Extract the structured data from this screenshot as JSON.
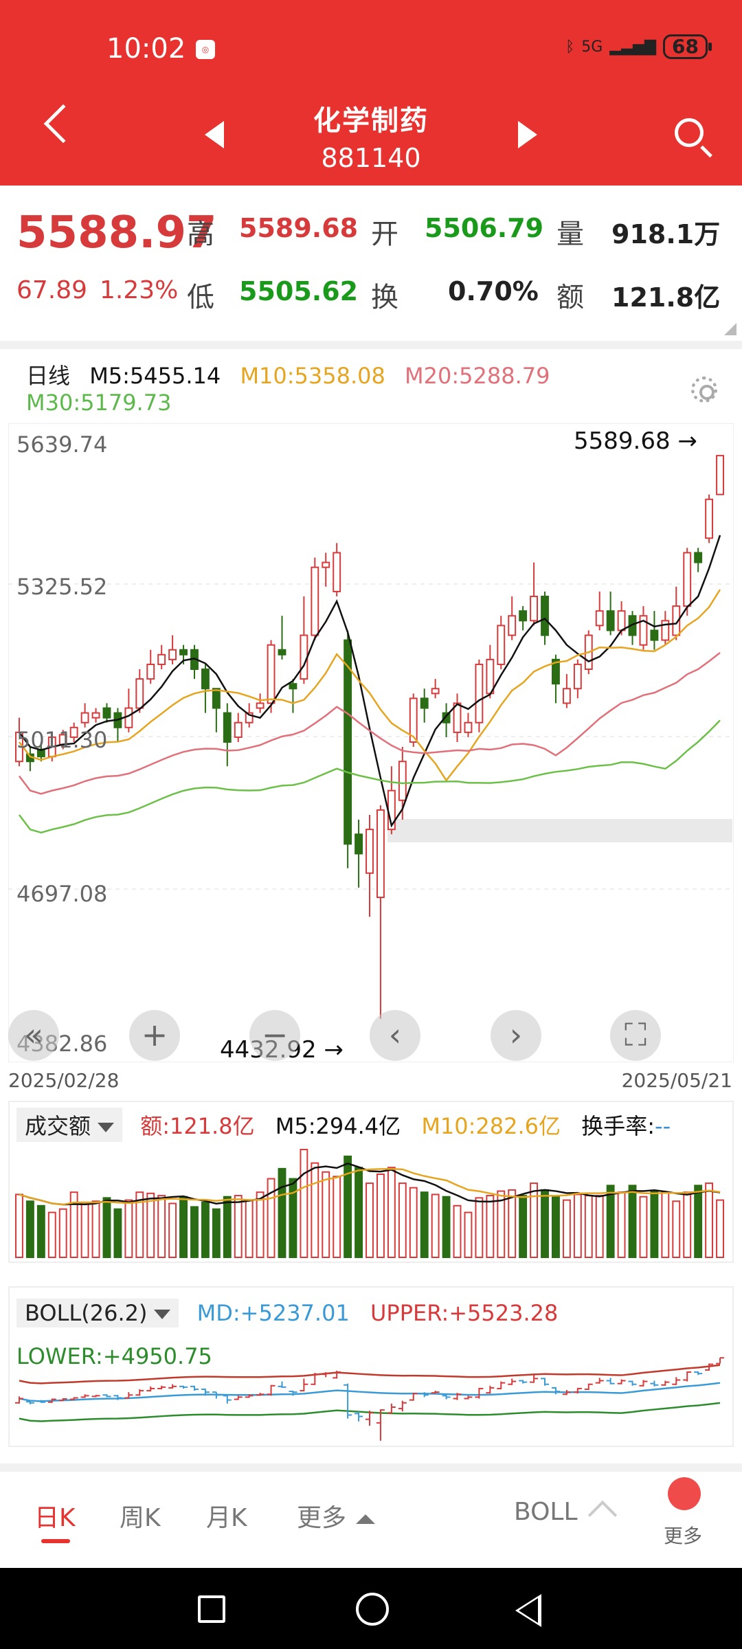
{
  "status": {
    "time": "10:02",
    "battery": "68",
    "signal": "5G"
  },
  "header": {
    "title": "化学制药",
    "code": "881140"
  },
  "quote": {
    "price": "5588.97",
    "change": "67.89",
    "change_pct": "1.23%",
    "high_label": "高",
    "high": "5589.68",
    "open_label": "开",
    "open": "5506.79",
    "vol_label": "量",
    "vol": "918.1万",
    "low_label": "低",
    "low": "5505.62",
    "turn_label": "换",
    "turn": "0.70%",
    "amt_label": "额",
    "amt": "121.8亿"
  },
  "ma": {
    "period": "日线",
    "m5": "M5:5455.14",
    "m10": "M10:5358.08",
    "m20": "M20:5288.79",
    "m30": "M30:5179.73"
  },
  "colors": {
    "up": "#d63a3a",
    "down": "#2a6d14",
    "m5": "#111111",
    "m10": "#e6a520",
    "m20": "#e0707a",
    "m30": "#6cc048",
    "accent": "#e8322f"
  },
  "kline": {
    "price_labels": [
      "5639.74",
      "5325.52",
      "5011.30",
      "4697.08",
      "4382.86"
    ],
    "date_start": "2025/02/28",
    "date_end": "2025/05/21",
    "max_anno": "5589.68",
    "min_anno": "4432.92",
    "ymin": 4382.86,
    "ymax": 5639.74,
    "candles": [
      [
        4960,
        5020,
        4950,
        5050
      ],
      [
        4975,
        4960,
        4940,
        4990
      ],
      [
        4985,
        4970,
        4960,
        5000
      ],
      [
        4970,
        5010,
        4960,
        5020
      ],
      [
        4995,
        5015,
        4985,
        5025
      ],
      [
        5010,
        5030,
        5000,
        5040
      ],
      [
        5040,
        5060,
        5030,
        5080
      ],
      [
        5050,
        5060,
        5040,
        5070
      ],
      [
        5070,
        5050,
        5040,
        5080
      ],
      [
        5060,
        5030,
        5000,
        5070
      ],
      [
        5030,
        5070,
        5020,
        5110
      ],
      [
        5070,
        5130,
        5060,
        5150
      ],
      [
        5130,
        5160,
        5120,
        5190
      ],
      [
        5160,
        5180,
        5150,
        5200
      ],
      [
        5170,
        5190,
        5160,
        5220
      ],
      [
        5190,
        5180,
        5160,
        5200
      ],
      [
        5190,
        5150,
        5130,
        5200
      ],
      [
        5150,
        5110,
        5060,
        5160
      ],
      [
        5110,
        5070,
        5020,
        5110
      ],
      [
        5060,
        5000,
        4950,
        5080
      ],
      [
        5010,
        5040,
        5000,
        5060
      ],
      [
        5040,
        5060,
        5030,
        5080
      ],
      [
        5070,
        5080,
        5060,
        5100
      ],
      [
        5080,
        5200,
        5060,
        5210
      ],
      [
        5190,
        5180,
        5170,
        5260
      ],
      [
        5120,
        5110,
        5060,
        5130
      ],
      [
        5130,
        5220,
        5120,
        5300
      ],
      [
        5220,
        5360,
        5210,
        5380
      ],
      [
        5360,
        5370,
        5320,
        5390
      ],
      [
        5310,
        5390,
        5300,
        5410
      ],
      [
        5210,
        4790,
        4740,
        5230
      ],
      [
        4810,
        4770,
        4700,
        4840
      ],
      [
        4730,
        4820,
        4640,
        4850
      ],
      [
        4680,
        4860,
        4430,
        4870
      ],
      [
        4820,
        4900,
        4810,
        4950
      ],
      [
        4880,
        4960,
        4840,
        4990
      ],
      [
        5000,
        5090,
        4990,
        5100
      ],
      [
        5090,
        5070,
        5040,
        5110
      ],
      [
        5100,
        5110,
        5090,
        5130
      ],
      [
        5060,
        5040,
        5010,
        5080
      ],
      [
        5020,
        5080,
        5000,
        5100
      ],
      [
        5020,
        5040,
        5010,
        5060
      ],
      [
        5040,
        5160,
        5020,
        5170
      ],
      [
        5100,
        5170,
        5090,
        5200
      ],
      [
        5160,
        5240,
        5150,
        5260
      ],
      [
        5220,
        5260,
        5210,
        5300
      ],
      [
        5270,
        5250,
        5230,
        5280
      ],
      [
        5250,
        5300,
        5240,
        5370
      ],
      [
        5300,
        5220,
        5200,
        5310
      ],
      [
        5170,
        5120,
        5080,
        5180
      ],
      [
        5080,
        5110,
        5070,
        5140
      ],
      [
        5110,
        5160,
        5090,
        5170
      ],
      [
        5150,
        5220,
        5140,
        5230
      ],
      [
        5240,
        5270,
        5230,
        5310
      ],
      [
        5270,
        5230,
        5220,
        5310
      ],
      [
        5230,
        5270,
        5220,
        5290
      ],
      [
        5260,
        5220,
        5200,
        5270
      ],
      [
        5200,
        5260,
        5190,
        5280
      ],
      [
        5230,
        5210,
        5190,
        5270
      ],
      [
        5210,
        5250,
        5200,
        5270
      ],
      [
        5220,
        5280,
        5210,
        5320
      ],
      [
        5280,
        5390,
        5260,
        5400
      ],
      [
        5390,
        5370,
        5350,
        5400
      ],
      [
        5420,
        5500,
        5410,
        5510
      ],
      [
        5510,
        5590,
        5510,
        5590
      ]
    ]
  },
  "volume": {
    "selector": "成交额",
    "amount": "额:121.8亿",
    "m5": "M5:294.4亿",
    "m10": "M10:282.6亿",
    "turn_label": "换手率:",
    "turn_val": "--",
    "bars": [
      280,
      250,
      230,
      200,
      215,
      290,
      245,
      250,
      265,
      215,
      255,
      290,
      285,
      275,
      240,
      270,
      225,
      245,
      215,
      270,
      275,
      255,
      290,
      350,
      395,
      350,
      480,
      420,
      380,
      360,
      450,
      400,
      330,
      370,
      400,
      330,
      310,
      290,
      280,
      270,
      230,
      200,
      265,
      275,
      295,
      300,
      275,
      330,
      300,
      270,
      255,
      280,
      275,
      275,
      320,
      290,
      320,
      270,
      295,
      290,
      250,
      290,
      320,
      330,
      255
    ]
  },
  "boll": {
    "label": "BOLL(26.2)",
    "md": "MD:+5237.01",
    "upper": "UPPER:+5523.28",
    "lower": "LOWER:+4950.75"
  },
  "tabs": {
    "day": "日K",
    "week": "周K",
    "month": "月K",
    "more": "更多",
    "indicator": "BOLL",
    "more2": "更多"
  }
}
